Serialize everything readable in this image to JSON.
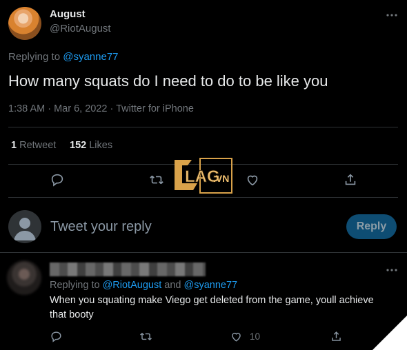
{
  "tweet": {
    "author_name": "August",
    "author_handle": "@RiotAugust",
    "replying_prefix": "Replying to ",
    "replying_handle": "@syanne77",
    "text": "How many squats do I need to do to be like you",
    "meta": "1:38 AM · Mar 6, 2022 · Twitter for iPhone",
    "retweets_count": "1",
    "retweets_label": "Retweet",
    "likes_count": "152",
    "likes_label": "Likes"
  },
  "compose": {
    "placeholder": "Tweet your reply",
    "button_label": "Reply"
  },
  "reply": {
    "replying_prefix": "Replying to ",
    "handle1": "@RiotAugust",
    "conjunction": " and ",
    "handle2": "@syanne77",
    "text_line1": "When you squating make Viego get deleted from the game, youll achieve",
    "text_line2": "that booty",
    "likes_count": "10"
  },
  "watermark": {
    "text": "LAG.VN",
    "brand_color": "#d9a24a"
  },
  "icons": {
    "more": "more-icon",
    "reply": "reply-icon",
    "retweet": "retweet-icon",
    "like": "like-icon",
    "share": "share-icon"
  }
}
